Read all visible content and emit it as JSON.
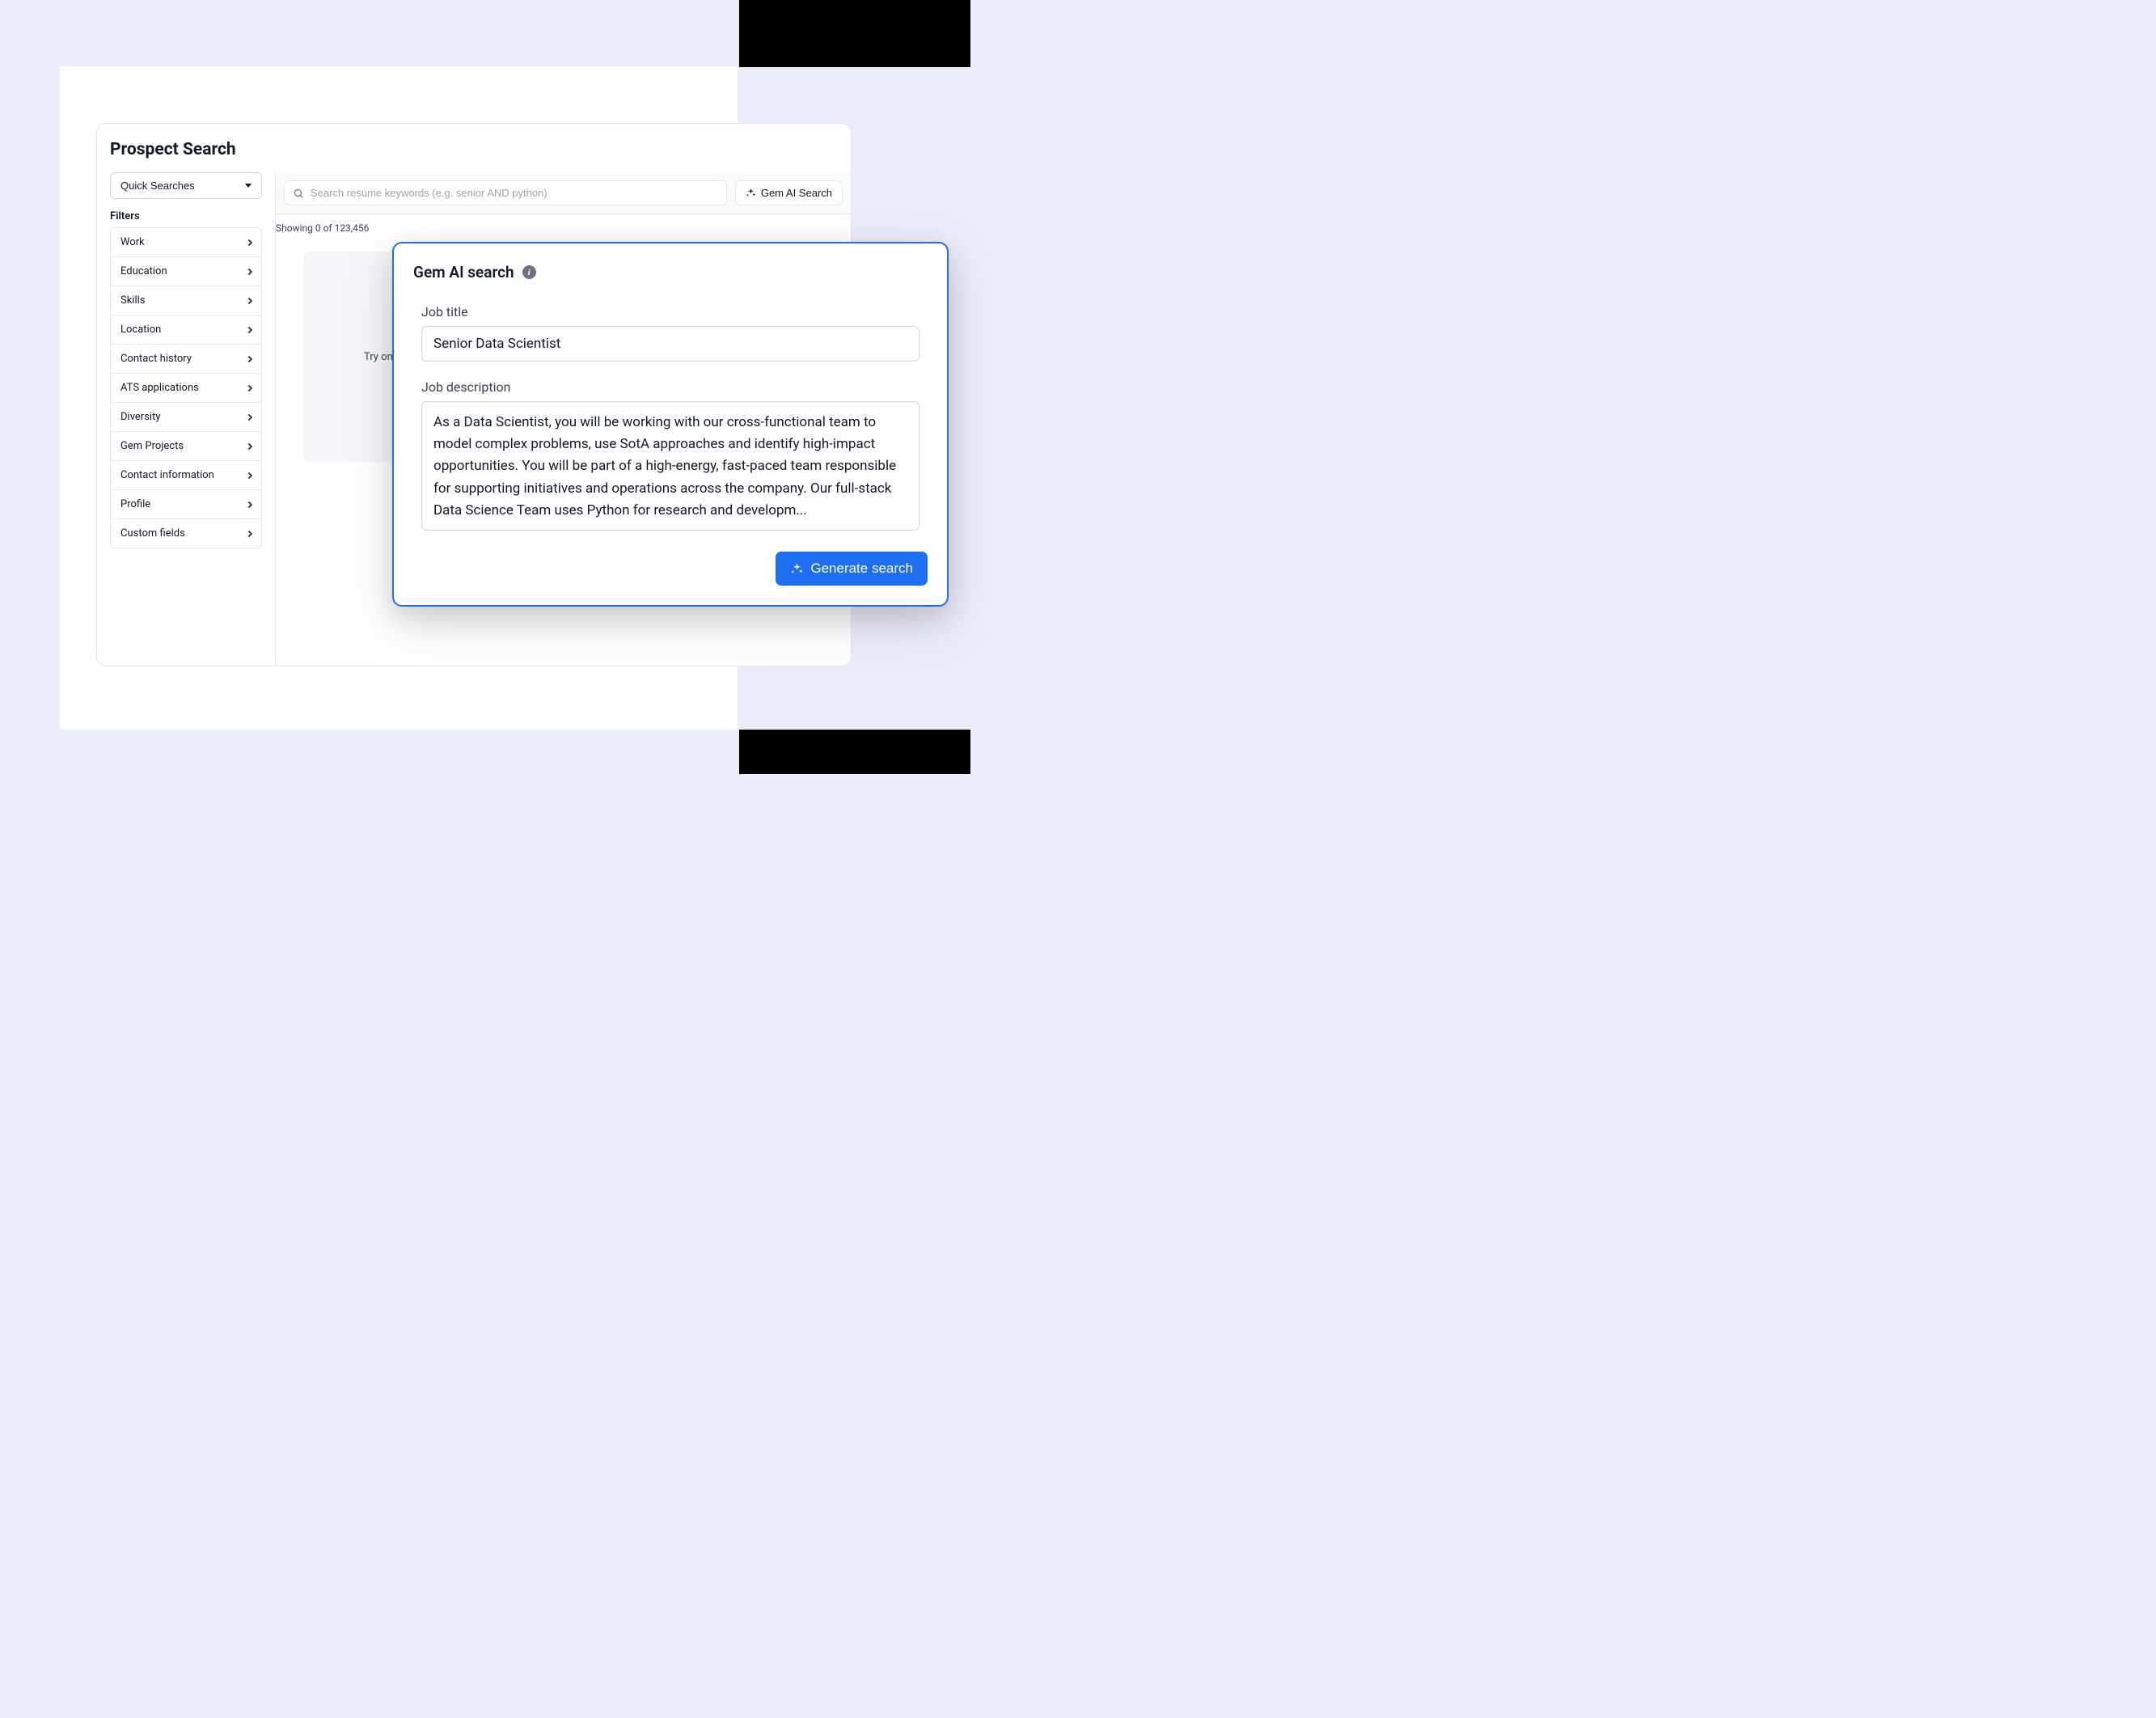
{
  "page": {
    "title": "Prospect Search"
  },
  "sidebar": {
    "quick_searches_label": "Quick Searches",
    "filters_heading": "Filters",
    "filters": [
      {
        "label": "Work"
      },
      {
        "label": "Education"
      },
      {
        "label": "Skills"
      },
      {
        "label": "Location"
      },
      {
        "label": "Contact history"
      },
      {
        "label": "ATS applications"
      },
      {
        "label": "Diversity"
      },
      {
        "label": "Gem Projects"
      },
      {
        "label": "Contact information"
      },
      {
        "label": "Profile"
      },
      {
        "label": "Custom fields"
      }
    ]
  },
  "search": {
    "placeholder": "Search resume keywords (e.g. senior AND python)",
    "ai_button_label": "Gem AI Search",
    "results_text": "Showing 0 of 123,456",
    "try_text": "Try on"
  },
  "modal": {
    "title": "Gem AI search",
    "job_title_label": "Job title",
    "job_title_value": "Senior Data Scientist",
    "job_description_label": "Job description",
    "job_description_value": "As a Data Scientist, you will be working with our cross-functional team to model complex problems, use SotA approaches and identify high-impact opportunities. You will be part of a high-energy, fast-paced team responsible for supporting initiatives and operations across the company. Our full-stack Data Science Team uses Python for research and developm...",
    "generate_button_label": "Generate search"
  }
}
